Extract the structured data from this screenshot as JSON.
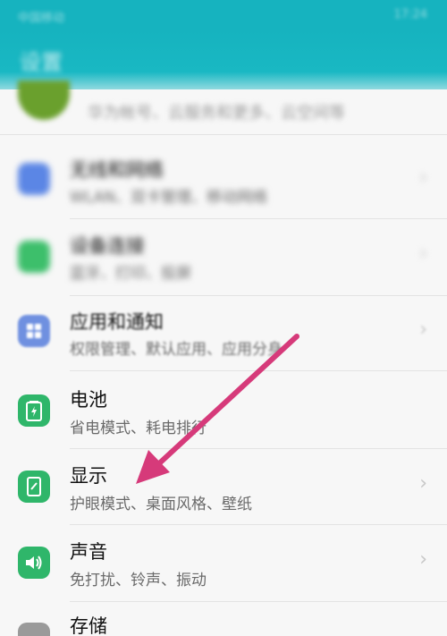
{
  "status_bar": {
    "left": "中国移动",
    "right": "17:24"
  },
  "app_bar": {
    "title": "设置"
  },
  "top_item": {
    "subtitle": "华为帐号、云服务和更多、云空间等"
  },
  "items": [
    {
      "label": "无线和网络",
      "desc": "WLAN、双卡管理、移动网络",
      "icon": "wifi-icon",
      "color": "#5b86e5"
    },
    {
      "label": "设备连接",
      "desc": "蓝牙、打印、投屏",
      "icon": "device-connect-icon",
      "color": "#3dbf6b"
    },
    {
      "label": "应用和通知",
      "desc": "权限管理、默认应用、应用分身",
      "icon": "apps-icon",
      "color": "#5b86e5"
    },
    {
      "label": "电池",
      "desc": "省电模式、耗电排行",
      "icon": "battery-icon",
      "color": "#2fb66a"
    },
    {
      "label": "显示",
      "desc": "护眼模式、桌面风格、壁纸",
      "icon": "display-icon",
      "color": "#2fb66a"
    },
    {
      "label": "声音",
      "desc": "免打扰、铃声、振动",
      "icon": "sound-icon",
      "color": "#2fb66a"
    },
    {
      "label": "存储",
      "desc": "",
      "icon": "storage-icon",
      "color": "#9a9a9a"
    }
  ],
  "annotation": {
    "color": "#d63a7a"
  }
}
